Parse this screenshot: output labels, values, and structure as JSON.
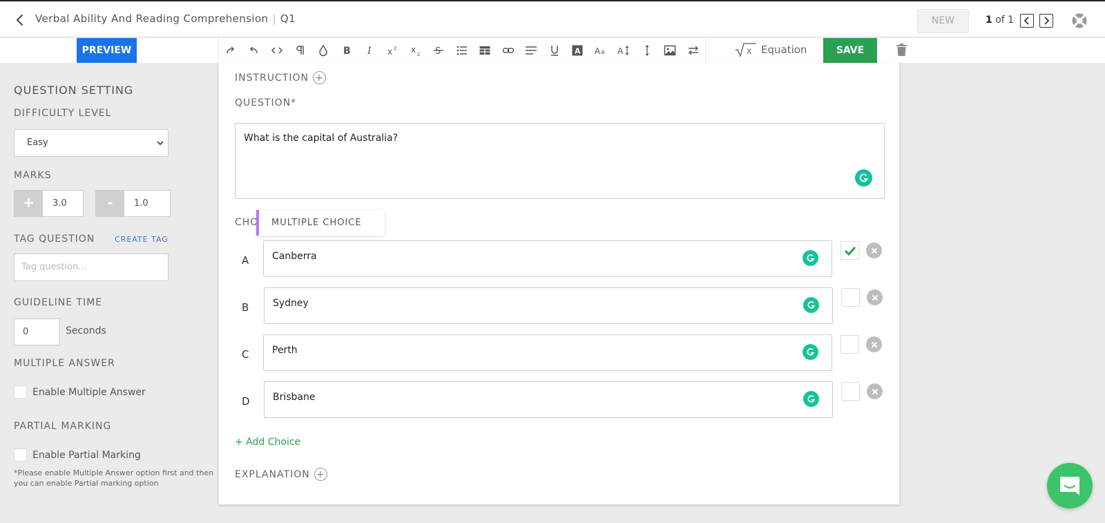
{
  "header": {
    "title": "Verbal Ability And Reading Comprehension",
    "separator": "|",
    "question_id": "Q1",
    "new_label": "NEW",
    "pager_current": "1",
    "pager_of": "of 1"
  },
  "toolbar": {
    "preview_label": "PREVIEW",
    "save_label": "SAVE",
    "equation_label": "Equation",
    "tools": [
      "redo-icon",
      "undo-icon",
      "code-view-icon",
      "paragraph-icon",
      "color-drop-icon",
      "bold-icon",
      "italic-icon",
      "superscript-icon",
      "subscript-icon",
      "strikethrough-icon",
      "bullet-list-icon",
      "table-icon",
      "link-icon",
      "align-icon",
      "underline-icon",
      "text-color-icon",
      "font-size-icon",
      "line-height-icon",
      "vertical-align-icon",
      "image-icon",
      "swap-icon"
    ]
  },
  "sidebar": {
    "heading": "QUESTION SETTING",
    "difficulty_label": "DIFFICULTY LEVEL",
    "difficulty_value": "Easy",
    "marks_label": "MARKS",
    "positive_sign": "+",
    "positive_value": "3.0",
    "negative_sign": "-",
    "negative_value": "1.0",
    "tag_label": "TAG QUESTION",
    "create_tag": "CREATE TAG",
    "tag_placeholder": "Tag question...",
    "guideline_label": "GUIDELINE TIME",
    "guideline_value": "0",
    "guideline_unit": "Seconds",
    "multiple_answer_label": "MULTIPLE ANSWER",
    "multiple_answer_option": "Enable Multiple Answer",
    "partial_marking_label": "PARTIAL MARKING",
    "partial_marking_option": "Enable Partial Marking",
    "partial_note": "*Please enable Multiple Answer option first and then you can enable Partial marking option"
  },
  "editor": {
    "instruction_label": "INSTRUCTION",
    "question_label": "QUESTION*",
    "question_text": "What is the capital of Australia?",
    "choices_label": "CHOICES",
    "choice_type_tooltip": "MULTIPLE CHOICE",
    "choices": [
      {
        "letter": "A",
        "text": "Canberra",
        "correct": true
      },
      {
        "letter": "B",
        "text": "Sydney",
        "correct": false
      },
      {
        "letter": "C",
        "text": "Perth",
        "correct": false
      },
      {
        "letter": "D",
        "text": "Brisbane",
        "correct": false
      }
    ],
    "add_choice_label": "+ Add Choice",
    "explanation_label": "EXPLANATION"
  },
  "colors": {
    "preview_blue": "#1a73e8",
    "save_green": "#2aa052",
    "grammarly_green": "#15c39a",
    "tooltip_accent": "#b07cf0",
    "chat_green": "#3cc46a"
  }
}
